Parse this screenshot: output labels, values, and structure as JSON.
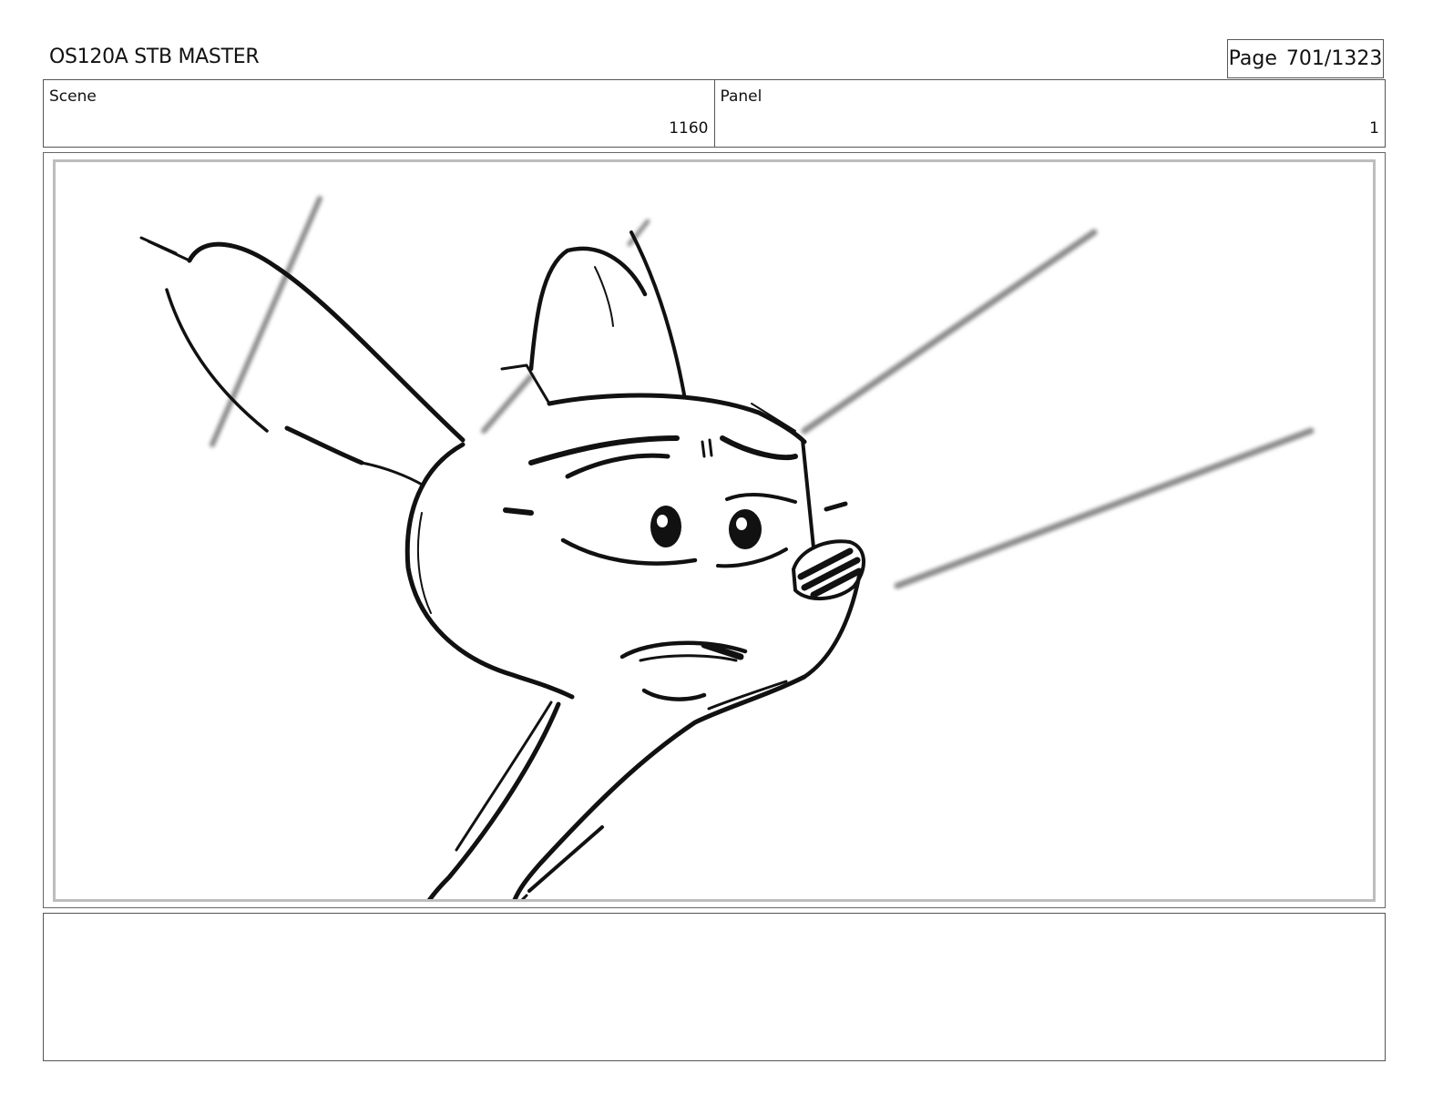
{
  "header": {
    "title": "OS120A STB MASTER",
    "page_label": "Page",
    "page_number": "701/1323"
  },
  "info": {
    "scene_label": "Scene",
    "scene_value": "1160",
    "panel_label": "Panel",
    "panel_value": "1"
  },
  "panel_art": {
    "subject": "rough storyboard sketch of a cartoon character head with motion lines",
    "colors": {
      "ink": "#111111",
      "speed_lines": "#8a8a8a",
      "frame": "#bdbdbd"
    }
  },
  "notes": {
    "text": ""
  }
}
